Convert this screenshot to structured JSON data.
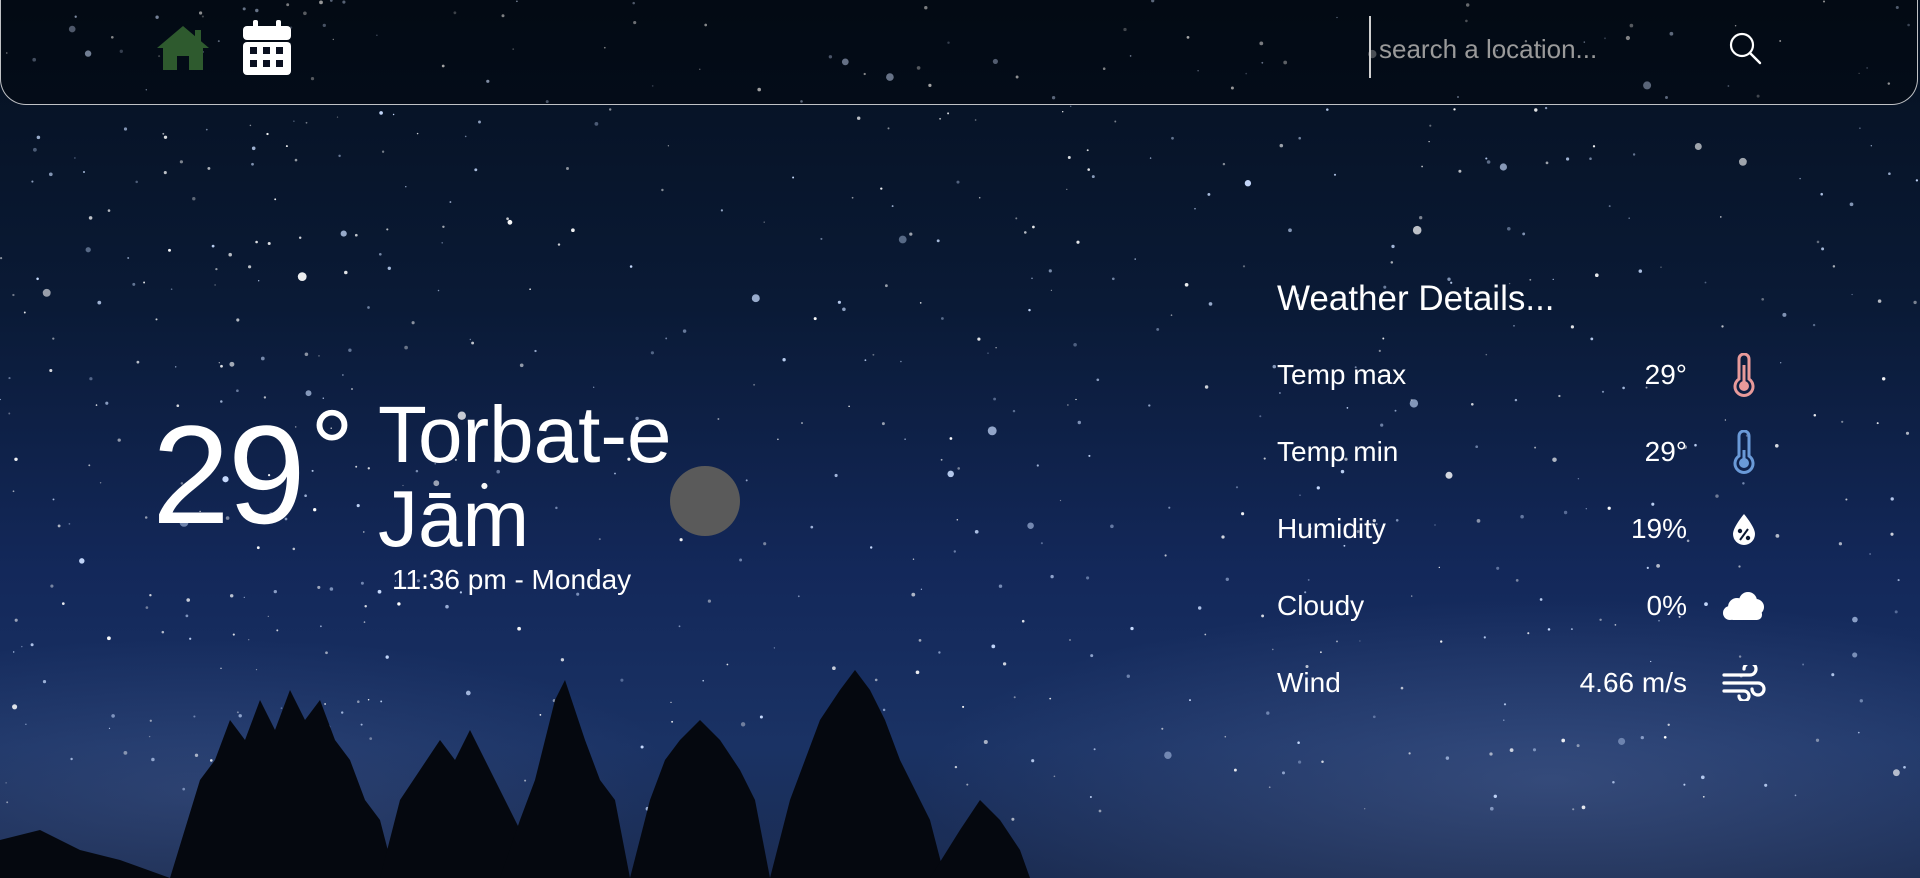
{
  "nav": {
    "home_icon": "home-icon",
    "calendar_icon": "calendar-icon",
    "active_color": "#2e5a2e"
  },
  "search": {
    "placeholder": "search a location...",
    "value": "",
    "icon": "search-icon"
  },
  "current": {
    "temperature": "29",
    "degree_symbol": "°",
    "city": "Torbat-e Jām",
    "datetime": "11:36 pm - Monday",
    "condition_icon": "moon-icon"
  },
  "details": {
    "title": "Weather Details...",
    "rows": [
      {
        "label": "Temp max",
        "value": "29°",
        "icon": "thermometer-hot-icon",
        "icon_color": "#e89a9a"
      },
      {
        "label": "Temp min",
        "value": "29°",
        "icon": "thermometer-cold-icon",
        "icon_color": "#6a9ad8"
      },
      {
        "label": "Humidity",
        "value": "19%",
        "icon": "humidity-drop-icon",
        "icon_color": "#ffffff"
      },
      {
        "label": "Cloudy",
        "value": "0%",
        "icon": "cloud-icon",
        "icon_color": "#ffffff"
      },
      {
        "label": "Wind",
        "value": "4.66 m/s",
        "icon": "wind-icon",
        "icon_color": "#ffffff"
      }
    ]
  }
}
